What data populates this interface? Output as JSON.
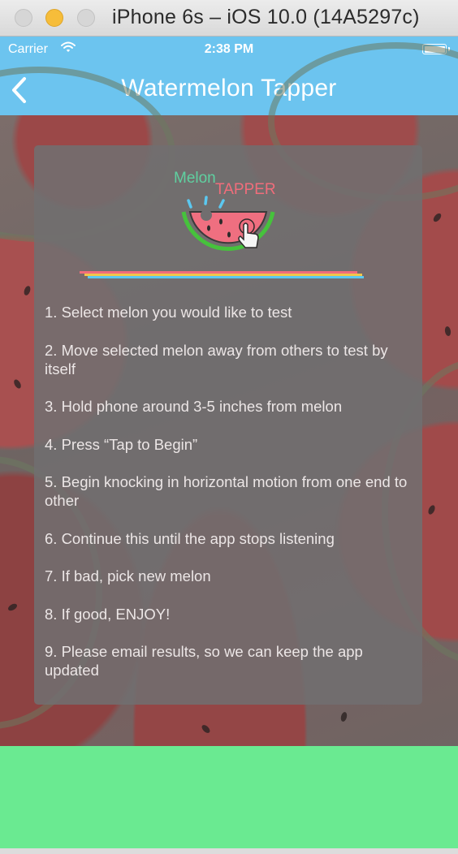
{
  "window": {
    "title": "iPhone 6s – iOS 10.0 (14A5297c)"
  },
  "status_bar": {
    "carrier": "Carrier",
    "time": "2:38 PM",
    "wifi_icon": "wifi-icon",
    "battery_icon": "battery-icon"
  },
  "nav": {
    "title": "Watermelon Tapper",
    "back_icon": "chevron-left-icon"
  },
  "logo": {
    "word1": "Melon",
    "word2": "TAPPER",
    "colors": {
      "melon": "#5fd0a0",
      "tapper": "#f06d7b",
      "rind": "#46c23c",
      "flesh": "#ef6f80",
      "drops": "#5bc8f0"
    }
  },
  "instructions": [
    "1. Select melon you would like to test",
    "2. Move selected melon away from others to test by itself",
    "3. Hold phone around 3-5 inches from melon",
    "4. Press “Tap to Begin”",
    "5. Begin knocking in horizontal motion from one end to other",
    "6. Continue this until the app stops listening",
    "7. If bad, pick new melon",
    "8. If good, ENJOY!",
    "9. Please email results, so we can keep the app updated"
  ],
  "colors": {
    "nav_bar": "#6cc4ef",
    "bottom_bar": "#6aea91",
    "card": "#716e6f"
  }
}
